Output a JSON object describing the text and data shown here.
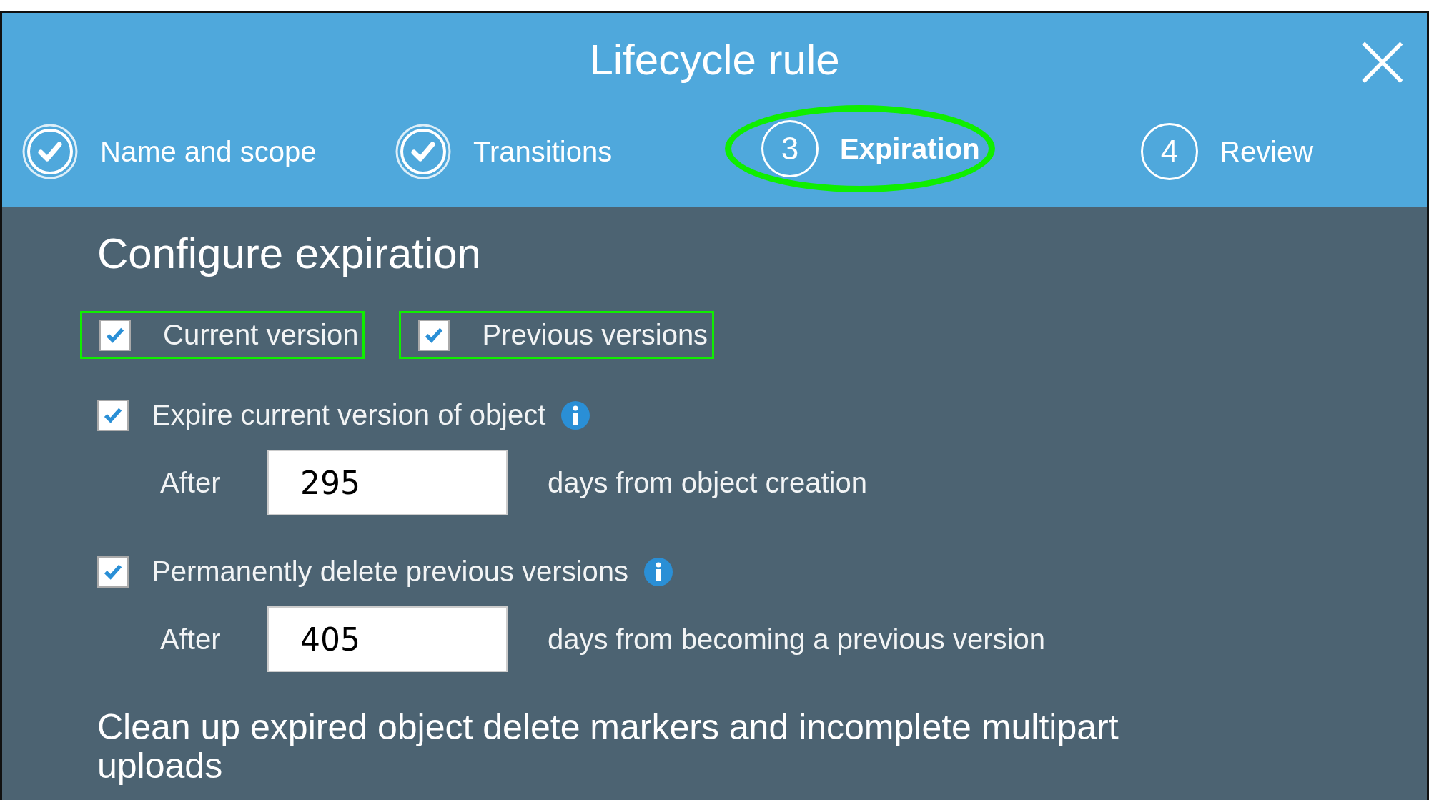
{
  "window": {
    "title": "Lifecycle rule",
    "close": "×"
  },
  "steps": [
    {
      "label": "Name and scope",
      "done": true,
      "selected": false
    },
    {
      "label": "Transitions",
      "done": true,
      "selected": false
    },
    {
      "label": "Expiration",
      "done": false,
      "number": "3",
      "selected": true
    },
    {
      "label": "Review",
      "done": false,
      "number": "4",
      "selected": false
    }
  ],
  "heading": "Configure expiration",
  "versions": [
    {
      "label": "Current version",
      "checked": true,
      "highlighted": true
    },
    {
      "label": "Previous versions",
      "checked": true,
      "highlighted": true
    }
  ],
  "rules": [
    {
      "label": "Expire current version of object",
      "checked": true,
      "after_label": "After",
      "value": "295",
      "suffix": "days from object creation"
    },
    {
      "label": "Permanently delete previous versions",
      "checked": true,
      "after_label": "After",
      "value": "405",
      "suffix": "days from becoming a previous version"
    }
  ],
  "cleanup_heading": "Clean up expired object delete markers and incomplete multipart uploads"
}
